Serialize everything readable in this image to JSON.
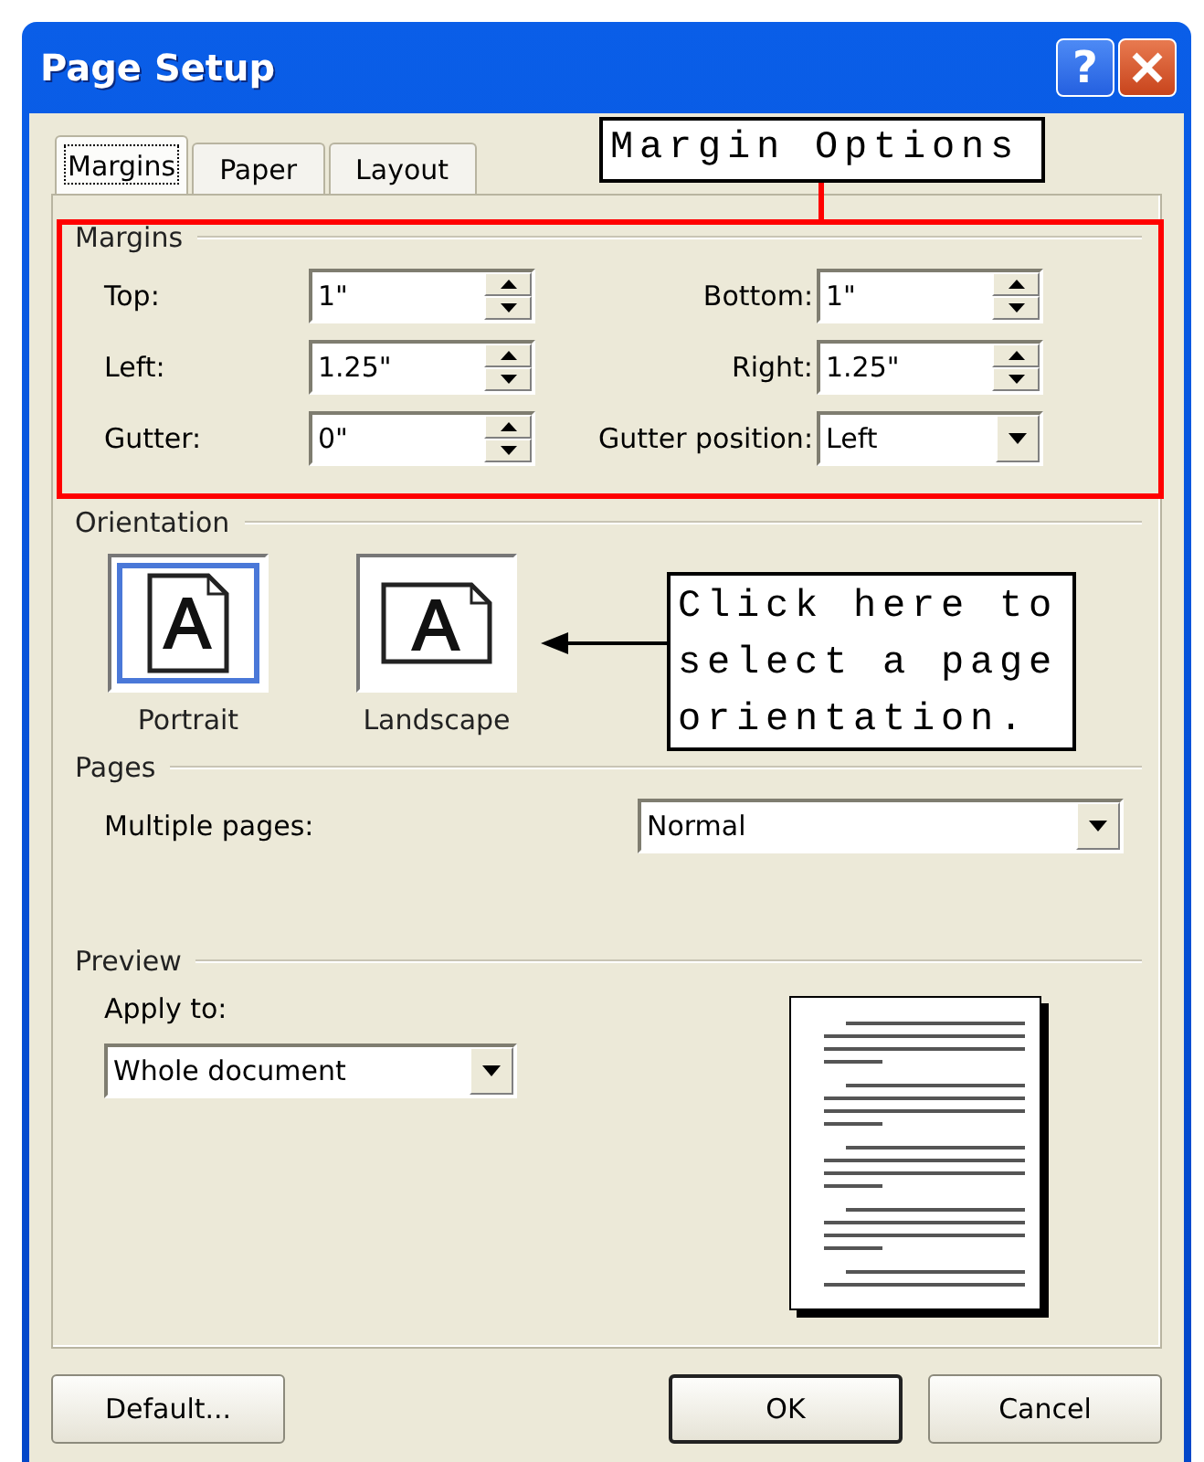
{
  "window": {
    "title": "Page Setup",
    "help_label": "?"
  },
  "tabs": [
    {
      "label": "Margins",
      "selected": true
    },
    {
      "label": "Paper",
      "selected": false
    },
    {
      "label": "Layout",
      "selected": false
    }
  ],
  "margins": {
    "title": "Margins",
    "fields": [
      {
        "label": "Top:",
        "value": "1\"",
        "kind": "spinner"
      },
      {
        "label": "Bottom:",
        "value": "1\"",
        "kind": "spinner"
      },
      {
        "label": "Left:",
        "value": "1.25\"",
        "kind": "spinner"
      },
      {
        "label": "Right:",
        "value": "1.25\"",
        "kind": "spinner"
      },
      {
        "label": "Gutter:",
        "value": "0\"",
        "kind": "spinner"
      },
      {
        "label": "Gutter position:",
        "value": "Left",
        "kind": "dropdown"
      }
    ]
  },
  "orientation": {
    "title": "Orientation",
    "options": [
      {
        "label": "Portrait",
        "kind": "portrait",
        "selected": true
      },
      {
        "label": "Landscape",
        "kind": "landscape",
        "selected": false
      }
    ]
  },
  "pages": {
    "title": "Pages",
    "multiple_pages": {
      "label": "Multiple pages:",
      "value": "Normal"
    }
  },
  "preview": {
    "title": "Preview",
    "apply_to": {
      "label": "Apply to:",
      "value": "Whole document"
    }
  },
  "buttons": [
    {
      "label": "Default...",
      "default": false
    },
    {
      "label": "OK",
      "default": true
    },
    {
      "label": "Cancel",
      "default": false
    }
  ],
  "annotations": [
    {
      "kind": "margin",
      "text": "Margin Options"
    },
    {
      "kind": "orientation",
      "text": "Click here to select a page orientation."
    }
  ]
}
